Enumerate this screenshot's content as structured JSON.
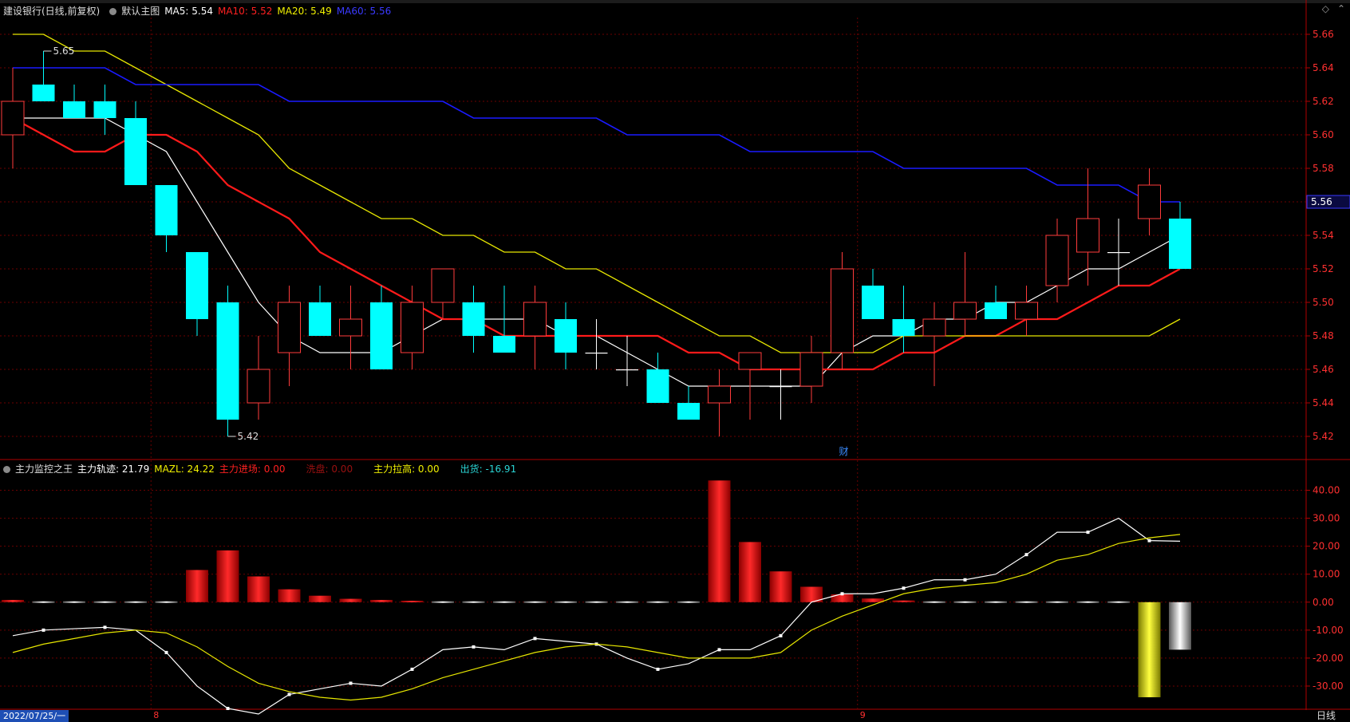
{
  "colors": {
    "up": "#ff3b3b",
    "down": "#00ffff",
    "flat": "#ffffff",
    "ma5": "#ffffff",
    "ma10": "#ff1a1a",
    "ma20": "#e6e600",
    "ma60": "#1a1aff",
    "grid": "#6b0000",
    "axis_text": "#ff3030",
    "divider": "#b00000"
  },
  "header_main": {
    "title": "建设银行(日线,前复权)",
    "template": "默认主图",
    "ma5": "MA5: 5.54",
    "ma10": "MA10: 5.52",
    "ma20": "MA20: 5.49",
    "ma60": "MA60: 5.56"
  },
  "header_sub": {
    "title": "主力监控之王",
    "track": "主力轨迹: 21.79",
    "mazl": "MAZL: 24.22",
    "enter": "主力进场: 0.00",
    "wash": "洗盘: 0.00",
    "raise": "主力拉高: 0.00",
    "sell": "出货: -16.91"
  },
  "footer": {
    "date": "2022/07/25/一",
    "period": "日线"
  },
  "chart_data": [
    {
      "type": "candlestick",
      "ylim": [
        5.41,
        5.67
      ],
      "y_ticks": [
        "5.66",
        "5.64",
        "5.62",
        "5.60",
        "5.58",
        "5.56",
        "5.54",
        "5.52",
        "5.50",
        "5.48",
        "5.46",
        "5.44",
        "5.42"
      ],
      "month_markers": [
        {
          "index": 5,
          "label": "8"
        },
        {
          "index": 28,
          "label": "9"
        }
      ],
      "annotations": [
        {
          "index": 1,
          "value": 5.65,
          "label": "5.65"
        },
        {
          "index": 7,
          "value": 5.42,
          "label": "5.42"
        },
        {
          "index": 27,
          "value": 5.41,
          "label": "财"
        }
      ],
      "current_price_label": "5.56",
      "candles": [
        {
          "o": 5.6,
          "h": 5.64,
          "l": 5.58,
          "c": 5.62
        },
        {
          "o": 5.63,
          "h": 5.65,
          "l": 5.62,
          "c": 5.62
        },
        {
          "o": 5.62,
          "h": 5.63,
          "l": 5.61,
          "c": 5.61
        },
        {
          "o": 5.62,
          "h": 5.63,
          "l": 5.6,
          "c": 5.61
        },
        {
          "o": 5.61,
          "h": 5.62,
          "l": 5.57,
          "c": 5.57
        },
        {
          "o": 5.57,
          "h": 5.57,
          "l": 5.53,
          "c": 5.54
        },
        {
          "o": 5.53,
          "h": 5.53,
          "l": 5.48,
          "c": 5.49
        },
        {
          "o": 5.5,
          "h": 5.51,
          "l": 5.42,
          "c": 5.43
        },
        {
          "o": 5.44,
          "h": 5.48,
          "l": 5.43,
          "c": 5.46
        },
        {
          "o": 5.47,
          "h": 5.51,
          "l": 5.45,
          "c": 5.5
        },
        {
          "o": 5.5,
          "h": 5.51,
          "l": 5.48,
          "c": 5.48
        },
        {
          "o": 5.48,
          "h": 5.51,
          "l": 5.46,
          "c": 5.49
        },
        {
          "o": 5.5,
          "h": 5.51,
          "l": 5.46,
          "c": 5.46
        },
        {
          "o": 5.47,
          "h": 5.51,
          "l": 5.46,
          "c": 5.5
        },
        {
          "o": 5.5,
          "h": 5.52,
          "l": 5.49,
          "c": 5.52
        },
        {
          "o": 5.5,
          "h": 5.51,
          "l": 5.47,
          "c": 5.48
        },
        {
          "o": 5.48,
          "h": 5.51,
          "l": 5.47,
          "c": 5.47
        },
        {
          "o": 5.48,
          "h": 5.51,
          "l": 5.46,
          "c": 5.5
        },
        {
          "o": 5.49,
          "h": 5.5,
          "l": 5.46,
          "c": 5.47
        },
        {
          "o": 5.47,
          "h": 5.49,
          "l": 5.46,
          "c": 5.47
        },
        {
          "o": 5.46,
          "h": 5.48,
          "l": 5.45,
          "c": 5.46
        },
        {
          "o": 5.46,
          "h": 5.47,
          "l": 5.44,
          "c": 5.44
        },
        {
          "o": 5.44,
          "h": 5.45,
          "l": 5.43,
          "c": 5.43
        },
        {
          "o": 5.44,
          "h": 5.46,
          "l": 5.42,
          "c": 5.45
        },
        {
          "o": 5.46,
          "h": 5.47,
          "l": 5.43,
          "c": 5.47
        },
        {
          "o": 5.45,
          "h": 5.46,
          "l": 5.43,
          "c": 5.45
        },
        {
          "o": 5.45,
          "h": 5.48,
          "l": 5.44,
          "c": 5.47
        },
        {
          "o": 5.47,
          "h": 5.53,
          "l": 5.46,
          "c": 5.52
        },
        {
          "o": 5.51,
          "h": 5.52,
          "l": 5.49,
          "c": 5.49
        },
        {
          "o": 5.49,
          "h": 5.51,
          "l": 5.47,
          "c": 5.48
        },
        {
          "o": 5.48,
          "h": 5.5,
          "l": 5.45,
          "c": 5.49
        },
        {
          "o": 5.49,
          "h": 5.53,
          "l": 5.48,
          "c": 5.5
        },
        {
          "o": 5.5,
          "h": 5.51,
          "l": 5.49,
          "c": 5.49
        },
        {
          "o": 5.49,
          "h": 5.51,
          "l": 5.48,
          "c": 5.5
        },
        {
          "o": 5.51,
          "h": 5.55,
          "l": 5.5,
          "c": 5.54
        },
        {
          "o": 5.53,
          "h": 5.58,
          "l": 5.51,
          "c": 5.55
        },
        {
          "o": 5.53,
          "h": 5.55,
          "l": 5.51,
          "c": 5.53
        },
        {
          "o": 5.55,
          "h": 5.58,
          "l": 5.54,
          "c": 5.57
        },
        {
          "o": 5.55,
          "h": 5.56,
          "l": 5.52,
          "c": 5.52
        }
      ],
      "series": [
        {
          "name": "MA5",
          "values": [
            5.61,
            5.61,
            5.61,
            5.61,
            5.6,
            5.59,
            5.56,
            5.53,
            5.5,
            5.48,
            5.47,
            5.47,
            5.47,
            5.48,
            5.49,
            5.49,
            5.49,
            5.49,
            5.48,
            5.48,
            5.47,
            5.46,
            5.45,
            5.45,
            5.45,
            5.45,
            5.45,
            5.47,
            5.48,
            5.48,
            5.49,
            5.49,
            5.5,
            5.5,
            5.51,
            5.52,
            5.52,
            5.53,
            5.54
          ]
        },
        {
          "name": "MA10",
          "values": [
            5.61,
            5.6,
            5.59,
            5.59,
            5.6,
            5.6,
            5.59,
            5.57,
            5.56,
            5.55,
            5.53,
            5.52,
            5.51,
            5.5,
            5.49,
            5.49,
            5.48,
            5.48,
            5.48,
            5.48,
            5.48,
            5.48,
            5.47,
            5.47,
            5.46,
            5.46,
            5.46,
            5.46,
            5.46,
            5.47,
            5.47,
            5.48,
            5.48,
            5.49,
            5.49,
            5.5,
            5.51,
            5.51,
            5.52
          ]
        },
        {
          "name": "MA20",
          "values": [
            5.66,
            5.66,
            5.65,
            5.65,
            5.64,
            5.63,
            5.62,
            5.61,
            5.6,
            5.58,
            5.57,
            5.56,
            5.55,
            5.55,
            5.54,
            5.54,
            5.53,
            5.53,
            5.52,
            5.52,
            5.51,
            5.5,
            5.49,
            5.48,
            5.48,
            5.47,
            5.47,
            5.47,
            5.47,
            5.48,
            5.48,
            5.48,
            5.48,
            5.48,
            5.48,
            5.48,
            5.48,
            5.48,
            5.49
          ]
        },
        {
          "name": "MA60",
          "values": [
            5.64,
            5.64,
            5.64,
            5.64,
            5.63,
            5.63,
            5.63,
            5.63,
            5.63,
            5.62,
            5.62,
            5.62,
            5.62,
            5.62,
            5.62,
            5.61,
            5.61,
            5.61,
            5.61,
            5.61,
            5.6,
            5.6,
            5.6,
            5.6,
            5.59,
            5.59,
            5.59,
            5.59,
            5.59,
            5.58,
            5.58,
            5.58,
            5.58,
            5.58,
            5.57,
            5.57,
            5.57,
            5.56,
            5.56
          ]
        }
      ]
    },
    {
      "type": "bar+line",
      "ylim": [
        -38,
        47
      ],
      "y_ticks": [
        "40.00",
        "30.00",
        "20.00",
        "10.00",
        "0.00",
        "-10.00",
        "-20.00",
        "-30.00"
      ],
      "bars": [
        0.8,
        0.3,
        0.3,
        0.3,
        0.3,
        0.3,
        11.5,
        18.5,
        9.2,
        4.6,
        2.3,
        1.2,
        0.8,
        0.5,
        0.3,
        0.3,
        0.3,
        0.3,
        0.3,
        0.3,
        0.3,
        0.3,
        0.3,
        43.5,
        21.5,
        11,
        5.5,
        2.8,
        1.3,
        0.6,
        0.3,
        0.3,
        0.3,
        0.3,
        0.3,
        0.3,
        0.3,
        -34,
        -17
      ],
      "bar_styles": [
        "red",
        "white",
        "white",
        "white",
        "white",
        "white",
        "red",
        "red",
        "red",
        "red",
        "red",
        "red",
        "red",
        "red",
        "white",
        "white",
        "white",
        "white",
        "white",
        "white",
        "white",
        "white",
        "white",
        "red",
        "red",
        "red",
        "red",
        "red",
        "red",
        "red",
        "white",
        "white",
        "white",
        "white",
        "white",
        "white",
        "white",
        "yellow",
        "white"
      ],
      "series": [
        {
          "name": "主力轨迹",
          "values": [
            -12,
            -10,
            -9.5,
            -9,
            -10,
            -18,
            -30,
            -38,
            -40,
            -33,
            -31,
            -29,
            -30,
            -24,
            -17,
            -16,
            -17,
            -13,
            -14,
            -15,
            -20,
            -24,
            -22,
            -17,
            -17,
            -12,
            0,
            3,
            3,
            5,
            8,
            8,
            10,
            17,
            25,
            25,
            30,
            22,
            21.79
          ]
        },
        {
          "name": "MAZL",
          "values": [
            -18,
            -15,
            -13,
            -11,
            -10,
            -11,
            -16,
            -23,
            -29,
            -32,
            -34,
            -35,
            -34,
            -31,
            -27,
            -24,
            -21,
            -18,
            -16,
            -15,
            -16,
            -18,
            -20,
            -20,
            -20,
            -18,
            -10,
            -5,
            -1,
            3,
            5,
            6,
            7,
            10,
            15,
            17,
            21,
            23,
            24.22
          ]
        }
      ]
    }
  ]
}
